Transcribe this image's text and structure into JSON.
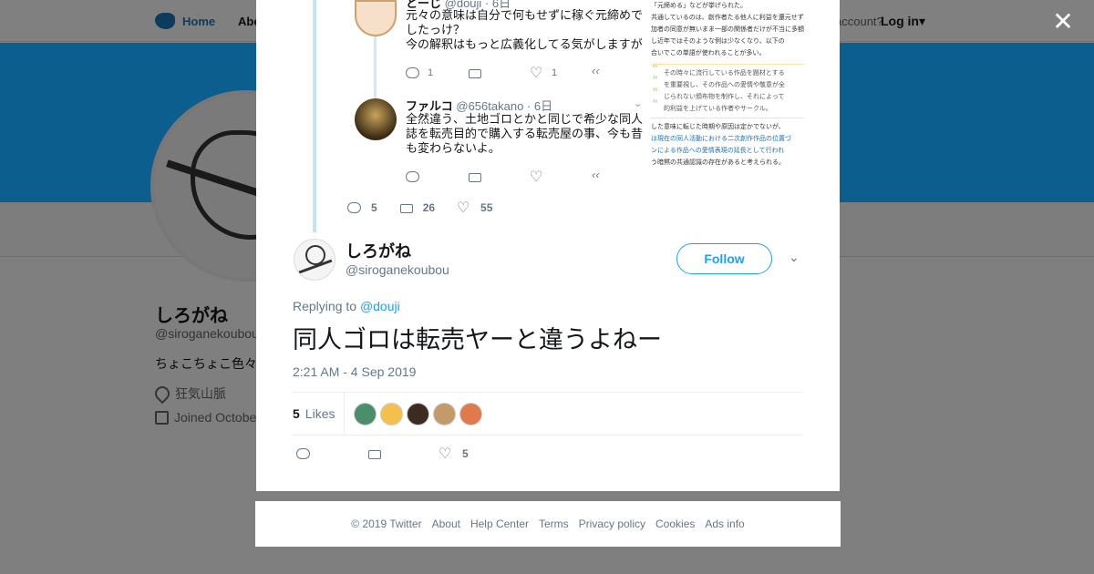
{
  "background": {
    "nav": {
      "home_label": "Home",
      "about_label": "Abo",
      "account_text": "account?",
      "login_label": "Log in",
      "login_caret": "▾"
    },
    "profile": {
      "name": "しろがね",
      "handle": "@siroganekoubou",
      "bio": "ちょこちょこ色々",
      "location": "狂気山脈",
      "joined": "Joined Octobe"
    }
  },
  "modal": {
    "close_glyph": "✕",
    "quoted_thread": {
      "tweet_a": {
        "name_partial": "とーじ",
        "handle_partial": "@douji · 6日",
        "text": "元々の意味は自分で何もせずに稼ぐ元締めでしたっけ？\n今の解釈はもっと広義化してる気がしますが",
        "reply_count": "1",
        "like_count": "1"
      },
      "tweet_b": {
        "name": "ファルコ",
        "handle": "@656takano · 6日",
        "text": "全然違う、土地ゴロとかと同じで希少な同人誌を転売目的で購入する転売屋の事、今も昔も変わらないよ。"
      },
      "main_counts": {
        "replies": "5",
        "retweets": "26",
        "likes": "55"
      },
      "article_lines": [
        "「元締める」などが挙げられた。",
        "共通しているのは、創作者たる他人に利益を還元せず、参",
        "加者の同意が無いまま一部の関係者だけが不当に多額の利",
        "し近年ではそのような例は少なくなり、以下の",
        "合いでこの単語が使われることが多い。",
        "その時々に流行している作品を題材とする",
        "を重要視し、その作品への愛情や敬意が全",
        "じられない頒布物を制作し、それによって",
        "的利益を上げている作者やサークル。",
        "した意味に転じた時期や原因は定かでないが、",
        "は現在の同人活動における二次創作作品の位置づ",
        "ンによる作品への愛情表現の延長として行われ",
        "う暗黙の共通認識の存在があると考えられる。"
      ]
    },
    "tweet": {
      "name": "しろがね",
      "handle": "@siroganekoubou",
      "follow_label": "Follow",
      "more_glyph": "⌄",
      "replying_prefix": "Replying to",
      "replying_handle": "@douji",
      "text": "同人ゴロは転売ヤーと違うよねー",
      "timestamp": "2:21 AM - 4 Sep 2019",
      "likes_count": "5",
      "likes_label": "Likes",
      "like_action_count": "5"
    },
    "likers": [
      {
        "color": "#4a8e6a"
      },
      {
        "color": "#f3c14b"
      },
      {
        "color": "#3b2b22"
      },
      {
        "color": "#c59a6a"
      },
      {
        "color": "#e07a4a"
      }
    ]
  },
  "footer": {
    "links": [
      "© 2019 Twitter",
      "About",
      "Help Center",
      "Terms",
      "Privacy policy",
      "Cookies",
      "Ads info"
    ]
  }
}
